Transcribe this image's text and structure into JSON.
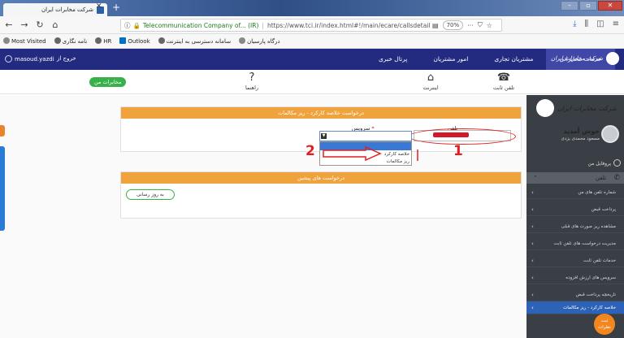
{
  "browser": {
    "tab_title": "شرکت مخابرات ایران",
    "url_site": "Telecommunication Company of... (IR)",
    "url_path": "https://www.tci.ir/index.html#!/main/ecare/callsdetail",
    "zoom": "70%",
    "bookmarks": [
      "Most Visited",
      "نامه نگاری",
      "HR",
      "Outlook",
      "سامانه دسترسی به اینترنت",
      "درگاه پارسیان"
    ]
  },
  "site": {
    "user_name": "masoud.yazdi",
    "logout": "خروج از",
    "menu": [
      "خدمات مخابراتی",
      "مشتریان تجاری",
      "امور مشتریان",
      "پرتال خبری"
    ],
    "logo_text": "شرکت مخابرات ایران",
    "my_services": "مخابرات من",
    "sub_icons": [
      {
        "label": "تلفن ثابت",
        "glyph": "☎"
      },
      {
        "label": "اینترنت",
        "glyph": "⌂"
      },
      {
        "label": "راهنما",
        "glyph": "?"
      }
    ]
  },
  "form": {
    "panel_title": "درخواست خلاصه کارکرد - ریز مکالمات",
    "phone_label": "تلفن",
    "service_label": "سرویس",
    "service_required": "*",
    "service_options": [
      "خلاصه کارکرد",
      "ریز مکالمات"
    ],
    "annotation_1": "1",
    "annotation_2": "2"
  },
  "previous": {
    "panel_title": "درخواست های پیشین",
    "resubmit_label": "به روز رسانی"
  },
  "sidebar": {
    "logo_text": "شرکت مخابرات ایران",
    "welcome": "خوش آمدید",
    "user_fullname": "مسعود محمدی یزدی",
    "profile": "پروفایل من",
    "section": "تلفن",
    "items": [
      "شماره تلفن های من",
      "پرداخت قبض",
      "مشاهده ریز صورت های قبلی",
      "مدیریت درخواست های تلفن ثابت",
      "خدمات تلفن ثابت",
      "سرویس های ارزش افزوده",
      "تاریخچه پرداخت قبض",
      "خلاصه کارکرد - ریز مکالمات"
    ],
    "feedback": "ثبت نظرات"
  }
}
